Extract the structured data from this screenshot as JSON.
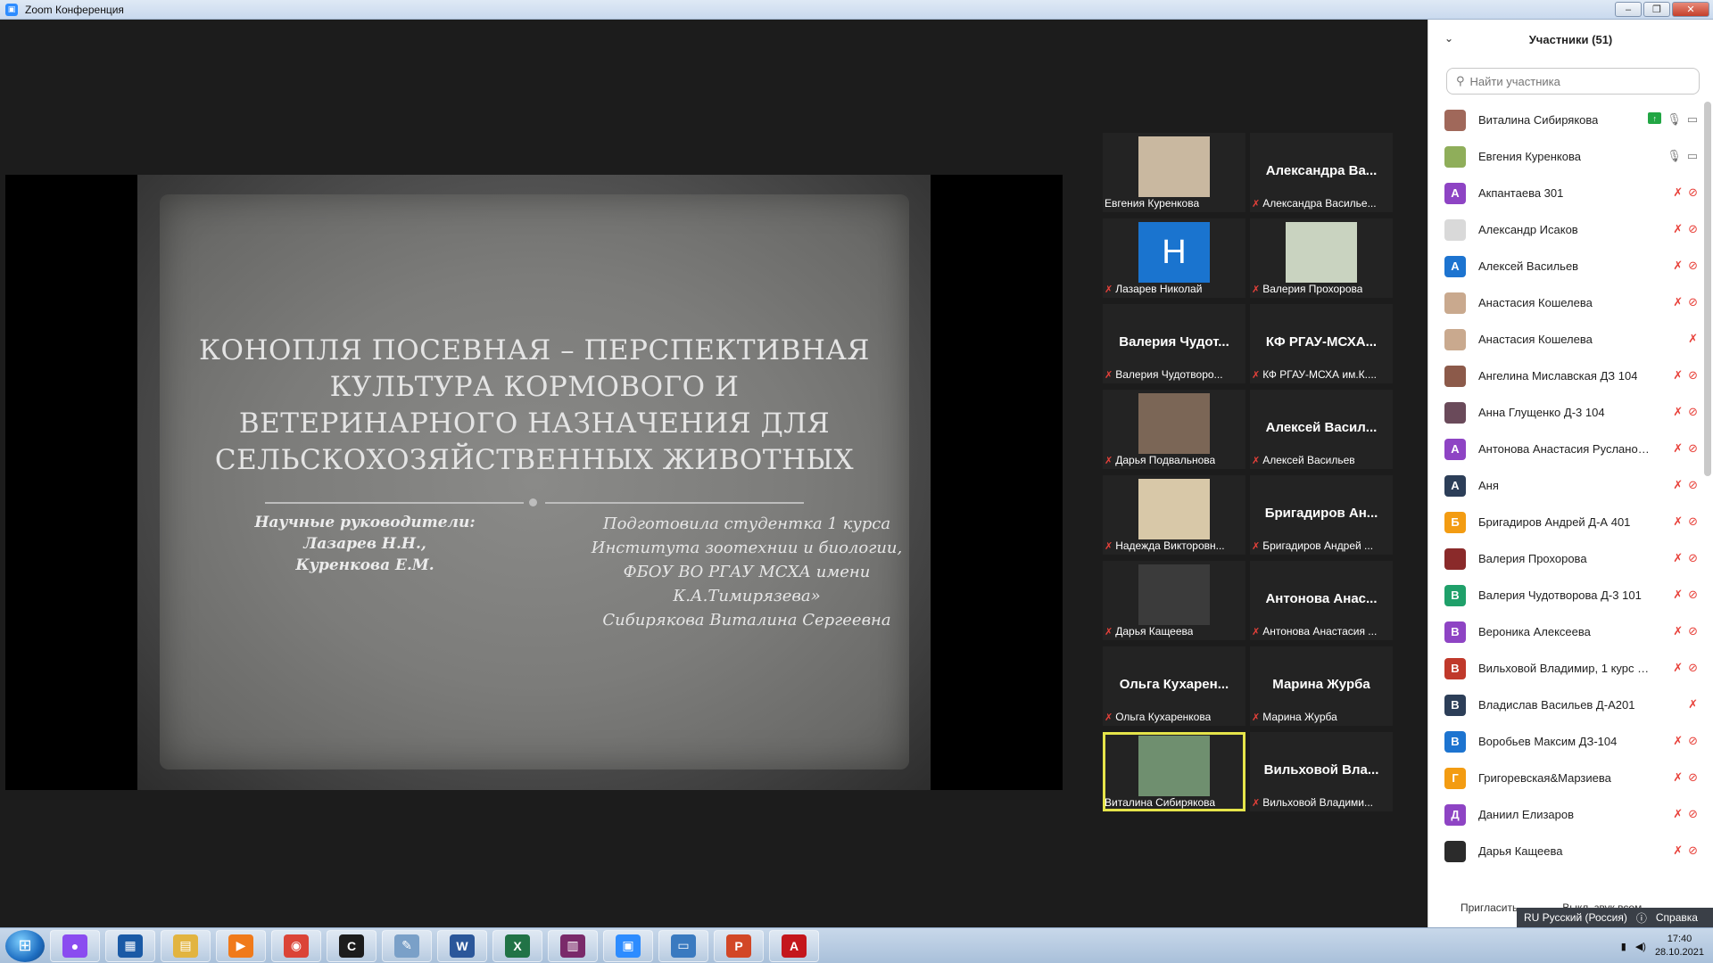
{
  "window": {
    "title": "Zoom Конференция"
  },
  "slide": {
    "title": "КОНОПЛЯ ПОСЕВНАЯ – ПЕРСПЕКТИВНАЯ КУЛЬТУРА КОРМОВОГО И ВЕТЕРИНАРНОГО НАЗНАЧЕНИЯ ДЛЯ СЕЛЬСКОХОЗЯЙСТВЕННЫХ ЖИВОТНЫХ",
    "supervisors": [
      "Научные руководители:",
      "Лазарев Н.Н.,",
      "Куренкова Е.М."
    ],
    "author": [
      "Подготовила студентка 1 курса",
      "Института зоотехнии и биологии,",
      "ФБОУ ВО  РГАУ МСХА имени",
      "К.А.Тимирязева»",
      "Сибирякова Виталина Сергеевна"
    ]
  },
  "tiles": [
    {
      "big": "",
      "caption": "Евгения Куренкова",
      "muted": false,
      "photo": "#c9b8a0"
    },
    {
      "big": "Александра  Ва...",
      "caption": "Александра Василье...",
      "muted": true
    },
    {
      "big": "",
      "caption": "Лазарев Николай",
      "muted": true,
      "photo": "#1a74cf",
      "letter": "H"
    },
    {
      "big": "",
      "caption": "Валерия Прохорова",
      "muted": true,
      "photo": "#c9d3c0"
    },
    {
      "big": "Валерия  Чудот...",
      "caption": "Валерия Чудотворо...",
      "muted": true
    },
    {
      "big": "КФ  РГАУ-МСХА...",
      "caption": "КФ РГАУ-МСХА им.К....",
      "muted": true
    },
    {
      "big": "",
      "caption": "Дарья Подвальнова",
      "muted": true,
      "photo": "#7b6656"
    },
    {
      "big": "Алексей  Васил...",
      "caption": "Алексей Васильев",
      "muted": true
    },
    {
      "big": "",
      "caption": "Надежда Викторовн...",
      "muted": true,
      "photo": "#d8c8a8"
    },
    {
      "big": "Бригадиров  Ан...",
      "caption": "Бригадиров Андрей ...",
      "muted": true
    },
    {
      "big": "",
      "caption": "Дарья Кащеева",
      "muted": true,
      "photo": "#3b3b3b"
    },
    {
      "big": "Антонова  Анас...",
      "caption": "Антонова Анастасия ...",
      "muted": true
    },
    {
      "big": "Ольга  Кухарен...",
      "caption": "Ольга Кухаренкова",
      "muted": true
    },
    {
      "big": "Марина  Журба",
      "caption": "Марина Журба",
      "muted": true
    },
    {
      "big": "",
      "caption": "Виталина Сибирякова",
      "muted": false,
      "photo": "#6f8f6f",
      "active": true
    },
    {
      "big": "Вильховой  Вла...",
      "caption": "Вильховой Владими...",
      "muted": true
    }
  ],
  "panel": {
    "title": "Участники (51)",
    "search_placeholder": "Найти участника",
    "participants": [
      {
        "name": "Виталина Сибирякова",
        "avatar": "",
        "color": "#a0685a",
        "icons": "share"
      },
      {
        "name": "Евгения Куренкова",
        "avatar": "",
        "color": "#8fae5a",
        "icons": "live"
      },
      {
        "name": "Акпантаева 301",
        "avatar": "А",
        "color": "#8e44c4",
        "icons": "muted"
      },
      {
        "name": "Александр Исаков",
        "avatar": "",
        "color": "#d9d9d9",
        "icons": "muted"
      },
      {
        "name": "Алексей Васильев",
        "avatar": "А",
        "color": "#1d74d0",
        "icons": "muted"
      },
      {
        "name": "Анастасия Кошелева",
        "avatar": "",
        "color": "#c9a98e",
        "icons": "muted"
      },
      {
        "name": "Анастасия Кошелева",
        "avatar": "",
        "color": "#c9a98e",
        "icons": "mic"
      },
      {
        "name": "Ангелина Миславская ДЗ 104",
        "avatar": "",
        "color": "#8c5a4a",
        "icons": "muted"
      },
      {
        "name": "Анна Глущенко Д-3 104",
        "avatar": "",
        "color": "#6a4a5a",
        "icons": "muted"
      },
      {
        "name": "Антонова Анастасия Руслановна",
        "avatar": "А",
        "color": "#8e44c4",
        "icons": "muted"
      },
      {
        "name": "Аня",
        "avatar": "А",
        "color": "#2c3e58",
        "icons": "muted"
      },
      {
        "name": "Бригадиров Андрей Д-А 401",
        "avatar": "Б",
        "color": "#f39c12",
        "icons": "muted"
      },
      {
        "name": "Валерия Прохорова",
        "avatar": "",
        "color": "#8a2a2a",
        "icons": "muted"
      },
      {
        "name": "Валерия Чудотворова Д-3 101",
        "avatar": "В",
        "color": "#1fa06a",
        "icons": "muted"
      },
      {
        "name": "Вероника Алексеева",
        "avatar": "В",
        "color": "#8e44c4",
        "icons": "muted"
      },
      {
        "name": "Вильховой Владимир, 1 курс м...",
        "avatar": "В",
        "color": "#c0392b",
        "icons": "muted"
      },
      {
        "name": "Владислав Васильев Д-А201",
        "avatar": "В",
        "color": "#2c3e58",
        "icons": "mic"
      },
      {
        "name": "Воробьев Максим ДЗ-104",
        "avatar": "В",
        "color": "#1d74d0",
        "icons": "muted"
      },
      {
        "name": "Григоревская&Марзиева",
        "avatar": "Г",
        "color": "#f39c12",
        "icons": "muted"
      },
      {
        "name": "Даниил Елизаров",
        "avatar": "Д",
        "color": "#8e44c4",
        "icons": "muted"
      },
      {
        "name": "Дарья Кащеева",
        "avatar": "",
        "color": "#2b2b2b",
        "icons": "muted"
      }
    ],
    "footer_invite": "Пригласить",
    "footer_mute": "Выкл. звук всем"
  },
  "langbar": {
    "lang": "RU Русский (Россия)",
    "help": "Справка"
  },
  "taskbar": {
    "apps": [
      {
        "name": "alice",
        "color": "#8a4cf0",
        "glyph": "●"
      },
      {
        "name": "app-grid",
        "color": "#1a5aa6",
        "glyph": "▦"
      },
      {
        "name": "file-explorer",
        "color": "#e2b440",
        "glyph": "▤"
      },
      {
        "name": "media-player",
        "color": "#f07a1a",
        "glyph": "▶"
      },
      {
        "name": "chrome",
        "color": "#db4437",
        "glyph": "◉"
      },
      {
        "name": "mathcad",
        "color": "#1c1c1c",
        "glyph": "C"
      },
      {
        "name": "paint",
        "color": "#7aa0c8",
        "glyph": "✎"
      },
      {
        "name": "word",
        "color": "#2b579a",
        "glyph": "W"
      },
      {
        "name": "excel",
        "color": "#217346",
        "glyph": "X"
      },
      {
        "name": "winrar",
        "color": "#7a2a6a",
        "glyph": "▥"
      },
      {
        "name": "zoom",
        "color": "#2d8cff",
        "glyph": "▣"
      },
      {
        "name": "image-viewer",
        "color": "#3a7ac0",
        "glyph": "▭"
      },
      {
        "name": "powerpoint",
        "color": "#d24726",
        "glyph": "P"
      },
      {
        "name": "acrobat",
        "color": "#c4161c",
        "glyph": "A"
      }
    ],
    "time": "17:40",
    "date": "28.10.2021"
  }
}
